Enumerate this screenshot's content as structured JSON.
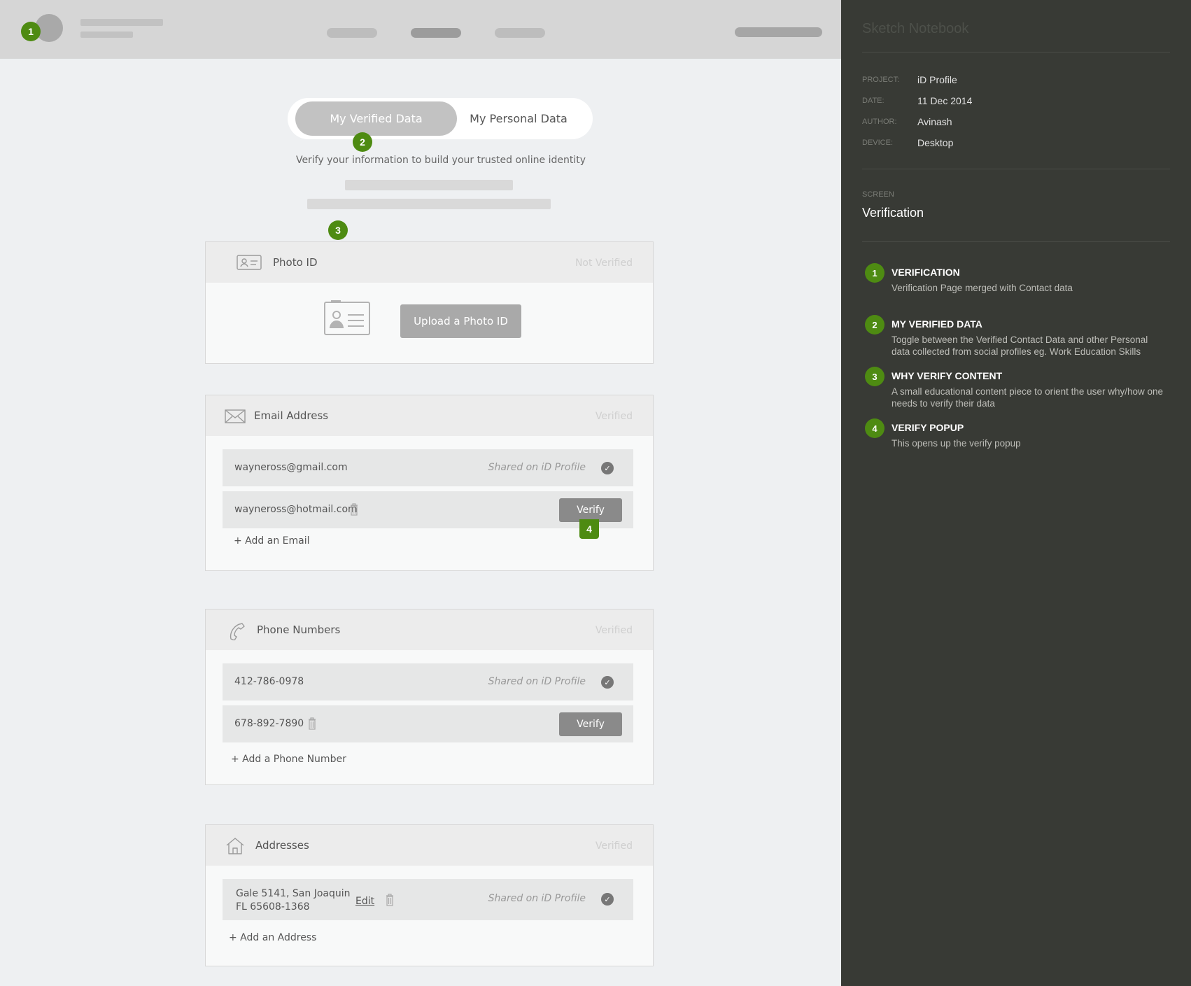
{
  "toggle": {
    "verified_label": "My Verified Data",
    "personal_label": "My Personal Data"
  },
  "subtitle": "Verify your information to build your trusted online identity",
  "markers": {
    "m1": "1",
    "m2": "2",
    "m3": "3",
    "m4": "4"
  },
  "photo_id": {
    "title": "Photo ID",
    "status": "Not Verified",
    "upload_label": "Upload a Photo ID"
  },
  "email": {
    "title": "Email Address",
    "status": "Verified",
    "rows": [
      {
        "value": "wayneross@gmail.com",
        "shared": "Shared on iD Profile"
      },
      {
        "value": "wayneross@hotmail.com",
        "verify_label": "Verify"
      }
    ],
    "add_label": "+ Add an Email"
  },
  "phone": {
    "title": "Phone Numbers",
    "status": "Verified",
    "rows": [
      {
        "value": "412-786-0978",
        "shared": "Shared on iD Profile"
      },
      {
        "value": "678-892-7890",
        "verify_label": "Verify"
      }
    ],
    "add_label": "+ Add a Phone Number"
  },
  "address": {
    "title": "Addresses",
    "status": "Verified",
    "rows": [
      {
        "line1": "Gale 5141, San Joaquin",
        "line2": "FL 65608-1368",
        "edit_label": "Edit",
        "shared": "Shared on iD Profile"
      }
    ],
    "add_label": "+ Add an Address"
  },
  "sidebar": {
    "title": "Sketch Notebook",
    "meta": [
      {
        "label": "PROJECT:",
        "value": "iD Profile"
      },
      {
        "label": "DATE:",
        "value": "11 Dec 2014"
      },
      {
        "label": "AUTHOR:",
        "value": "Avinash"
      },
      {
        "label": "DEVICE:",
        "value": "Desktop"
      }
    ],
    "screen_label": "SCREEN",
    "screen_name": "Verification",
    "notes": [
      {
        "num": "1",
        "title": "VERIFICATION",
        "desc": "Verification Page merged with Contact data"
      },
      {
        "num": "2",
        "title": "MY VERIFIED DATA",
        "desc": "Toggle between the Verified Contact Data and other Personal data collected from social profiles eg. Work Education Skills"
      },
      {
        "num": "3",
        "title": "WHY VERIFY CONTENT",
        "desc": "A small educational content piece to orient the user why/how one needs to verify their data"
      },
      {
        "num": "4",
        "title": "VERIFY POPUP",
        "desc": "This opens up the verify popup"
      }
    ]
  },
  "colors": {
    "accent_green": "#4e8b12",
    "sidebar_bg": "#383a35",
    "canvas_bg": "#eef0f2",
    "header_bg": "#d6d6d6"
  },
  "icons": [
    "id-card-icon",
    "contact-card-icon",
    "envelope-icon",
    "phone-icon",
    "home-icon",
    "trash-icon",
    "check-circle-icon"
  ]
}
